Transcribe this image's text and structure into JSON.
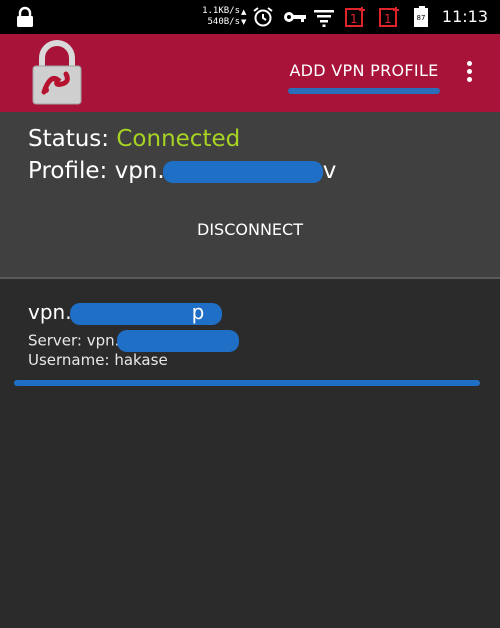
{
  "statusbar": {
    "upload_speed": "1.1KB/s",
    "download_speed": "540B/s",
    "battery_level": "87",
    "time": "11:13",
    "icons": [
      "lock-icon",
      "alarm-icon",
      "key-icon",
      "wifi-icon",
      "notification-icon",
      "notification-icon",
      "battery-icon"
    ]
  },
  "appbar": {
    "add_profile_label": "ADD VPN PROFILE",
    "accent": "#a8133a"
  },
  "status": {
    "status_label": "Status:",
    "status_value": "Connected",
    "status_color": "#a7d323",
    "profile_label": "Profile:",
    "profile_value_prefix": "vpn.",
    "profile_value_suffix": "v",
    "disconnect_label": "DISCONNECT"
  },
  "profiles": [
    {
      "name_prefix": "vpn.",
      "name_suffix": "p",
      "server_label": "Server:",
      "server_value_prefix": "vpn.",
      "username_label": "Username:",
      "username_value": "hakase"
    }
  ]
}
